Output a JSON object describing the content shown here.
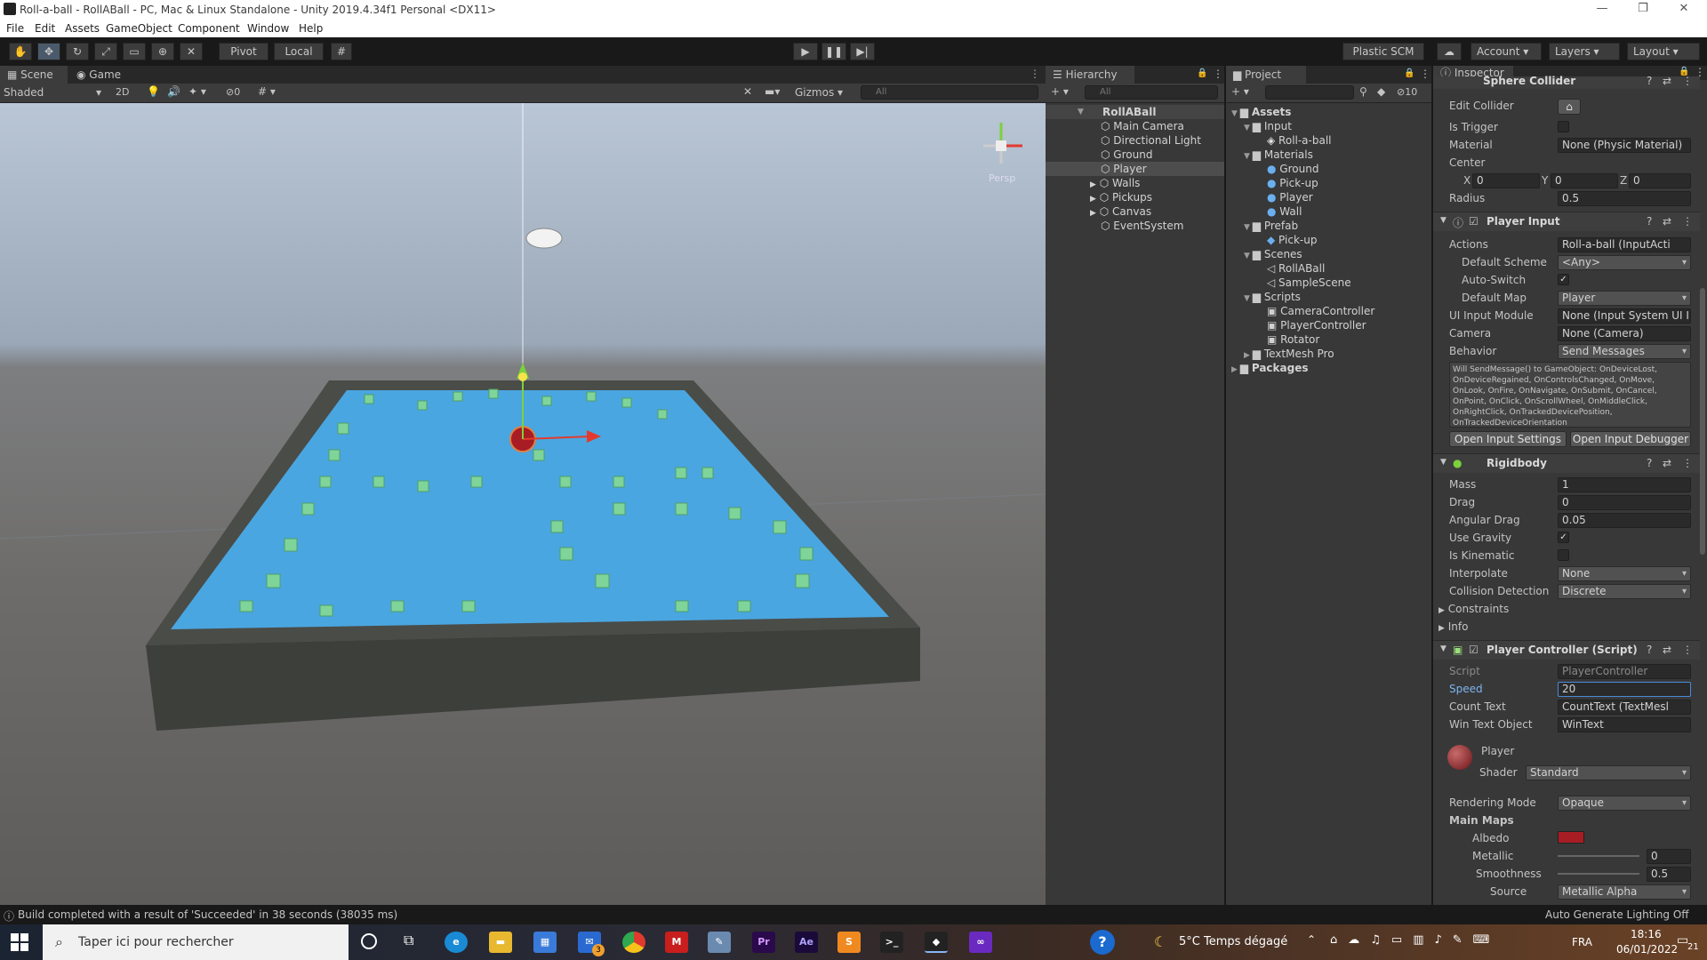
{
  "window": {
    "title": "Roll-a-ball - RollABall - PC, Mac & Linux Standalone - Unity 2019.4.34f1 Personal <DX11>"
  },
  "menu": [
    "File",
    "Edit",
    "Assets",
    "GameObject",
    "Component",
    "Window",
    "Help"
  ],
  "toolbar": {
    "pivot": "Pivot",
    "local": "Local",
    "plastic": "Plastic SCM",
    "account": "Account",
    "layers": "Layers",
    "layout": "Layout"
  },
  "scene": {
    "tab_scene": "Scene",
    "tab_game": "Game",
    "shading": "Shaded",
    "mode_2d": "2D",
    "hidden_count": "0",
    "gizmos": "Gizmos",
    "search_placeholder": "All",
    "persp": "Persp"
  },
  "hierarchy": {
    "tab": "Hierarchy",
    "search_placeholder": "All",
    "scene_name": "RollABall",
    "items": [
      "Main Camera",
      "Directional Light",
      "Ground",
      "Player",
      "Walls",
      "Pickups",
      "Canvas",
      "EventSystem"
    ],
    "selected": "Player"
  },
  "project": {
    "tab": "Project",
    "hidden_count": "10",
    "tree": [
      {
        "label": "Assets",
        "depth": 0,
        "kind": "folder",
        "expanded": true
      },
      {
        "label": "Input",
        "depth": 1,
        "kind": "folder",
        "expanded": true
      },
      {
        "label": "Roll-a-ball",
        "depth": 2,
        "kind": "input"
      },
      {
        "label": "Materials",
        "depth": 1,
        "kind": "folder",
        "expanded": true
      },
      {
        "label": "Ground",
        "depth": 2,
        "kind": "material"
      },
      {
        "label": "Pick-up",
        "depth": 2,
        "kind": "material"
      },
      {
        "label": "Player",
        "depth": 2,
        "kind": "material"
      },
      {
        "label": "Wall",
        "depth": 2,
        "kind": "material"
      },
      {
        "label": "Prefab",
        "depth": 1,
        "kind": "folder",
        "expanded": true
      },
      {
        "label": "Pick-up",
        "depth": 2,
        "kind": "prefab"
      },
      {
        "label": "Scenes",
        "depth": 1,
        "kind": "folder",
        "expanded": true
      },
      {
        "label": "RollABall",
        "depth": 2,
        "kind": "scene"
      },
      {
        "label": "SampleScene",
        "depth": 2,
        "kind": "scene"
      },
      {
        "label": "Scripts",
        "depth": 1,
        "kind": "folder",
        "expanded": true
      },
      {
        "label": "CameraController",
        "depth": 2,
        "kind": "script"
      },
      {
        "label": "PlayerController",
        "depth": 2,
        "kind": "script"
      },
      {
        "label": "Rotator",
        "depth": 2,
        "kind": "script"
      },
      {
        "label": "TextMesh Pro",
        "depth": 1,
        "kind": "folder",
        "expanded": false
      },
      {
        "label": "Packages",
        "depth": 0,
        "kind": "folder",
        "expanded": false
      }
    ]
  },
  "inspector": {
    "tab": "Inspector",
    "sphere_collider": {
      "title": "Sphere Collider",
      "edit_collider": "Edit Collider",
      "is_trigger": "Is Trigger",
      "material_label": "Material",
      "material_value": "None (Physic Material)",
      "center_label": "Center",
      "center_x": "0",
      "center_y": "0",
      "center_z": "0",
      "radius_label": "Radius",
      "radius_value": "0.5"
    },
    "player_input": {
      "title": "Player Input",
      "actions_label": "Actions",
      "actions_value": "Roll-a-ball (InputActi",
      "default_scheme_label": "Default Scheme",
      "default_scheme_value": "<Any>",
      "auto_switch_label": "Auto-Switch",
      "default_map_label": "Default Map",
      "default_map_value": "Player",
      "ui_input_label": "UI Input Module",
      "ui_input_value": "None (Input System UI I",
      "camera_label": "Camera",
      "camera_value": "None (Camera)",
      "behavior_label": "Behavior",
      "behavior_value": "Send Messages",
      "help_text": "Will SendMessage() to GameObject: OnDeviceLost, OnDeviceRegained, OnControlsChanged, OnMove, OnLook, OnFire, OnNavigate, OnSubmit, OnCancel, OnPoint, OnClick, OnScrollWheel, OnMiddleClick, OnRightClick, OnTrackedDevicePosition, OnTrackedDeviceOrientation",
      "open_settings": "Open Input Settings",
      "open_debugger": "Open Input Debugger"
    },
    "rigidbody": {
      "title": "Rigidbody",
      "mass_label": "Mass",
      "mass_value": "1",
      "drag_label": "Drag",
      "drag_value": "0",
      "angular_drag_label": "Angular Drag",
      "angular_drag_value": "0.05",
      "use_gravity_label": "Use Gravity",
      "is_kinematic_label": "Is Kinematic",
      "interpolate_label": "Interpolate",
      "interpolate_value": "None",
      "collision_label": "Collision Detection",
      "collision_value": "Discrete",
      "constraints": "Constraints",
      "info": "Info"
    },
    "player_controller": {
      "title": "Player Controller (Script)",
      "script_label": "Script",
      "script_value": "PlayerController",
      "speed_label": "Speed",
      "speed_value": "20",
      "count_text_label": "Count Text",
      "count_text_value": "CountText (TextMesl",
      "win_text_label": "Win Text Object",
      "win_text_value": "WinText"
    },
    "material": {
      "name": "Player",
      "shader_label": "Shader",
      "shader_value": "Standard",
      "rendering_mode_label": "Rendering Mode",
      "rendering_mode_value": "Opaque",
      "main_maps": "Main Maps",
      "albedo": "Albedo",
      "albedo_color": "#a81c24",
      "metallic": "Metallic",
      "metallic_value": "0",
      "smoothness": "Smoothness",
      "smoothness_value": "0.5",
      "source": "Source",
      "source_value": "Metallic Alpha"
    }
  },
  "status": {
    "message": "Build completed with a result of 'Succeeded' in 38 seconds (38035 ms)",
    "lighting": "Auto Generate Lighting Off"
  },
  "taskbar": {
    "search_placeholder": "Taper ici pour rechercher",
    "mail_badge": "3",
    "weather": "5°C  Temps dégagé",
    "lang": "FRA",
    "time": "18:16",
    "date": "06/01/2022",
    "notif_count": "21"
  }
}
